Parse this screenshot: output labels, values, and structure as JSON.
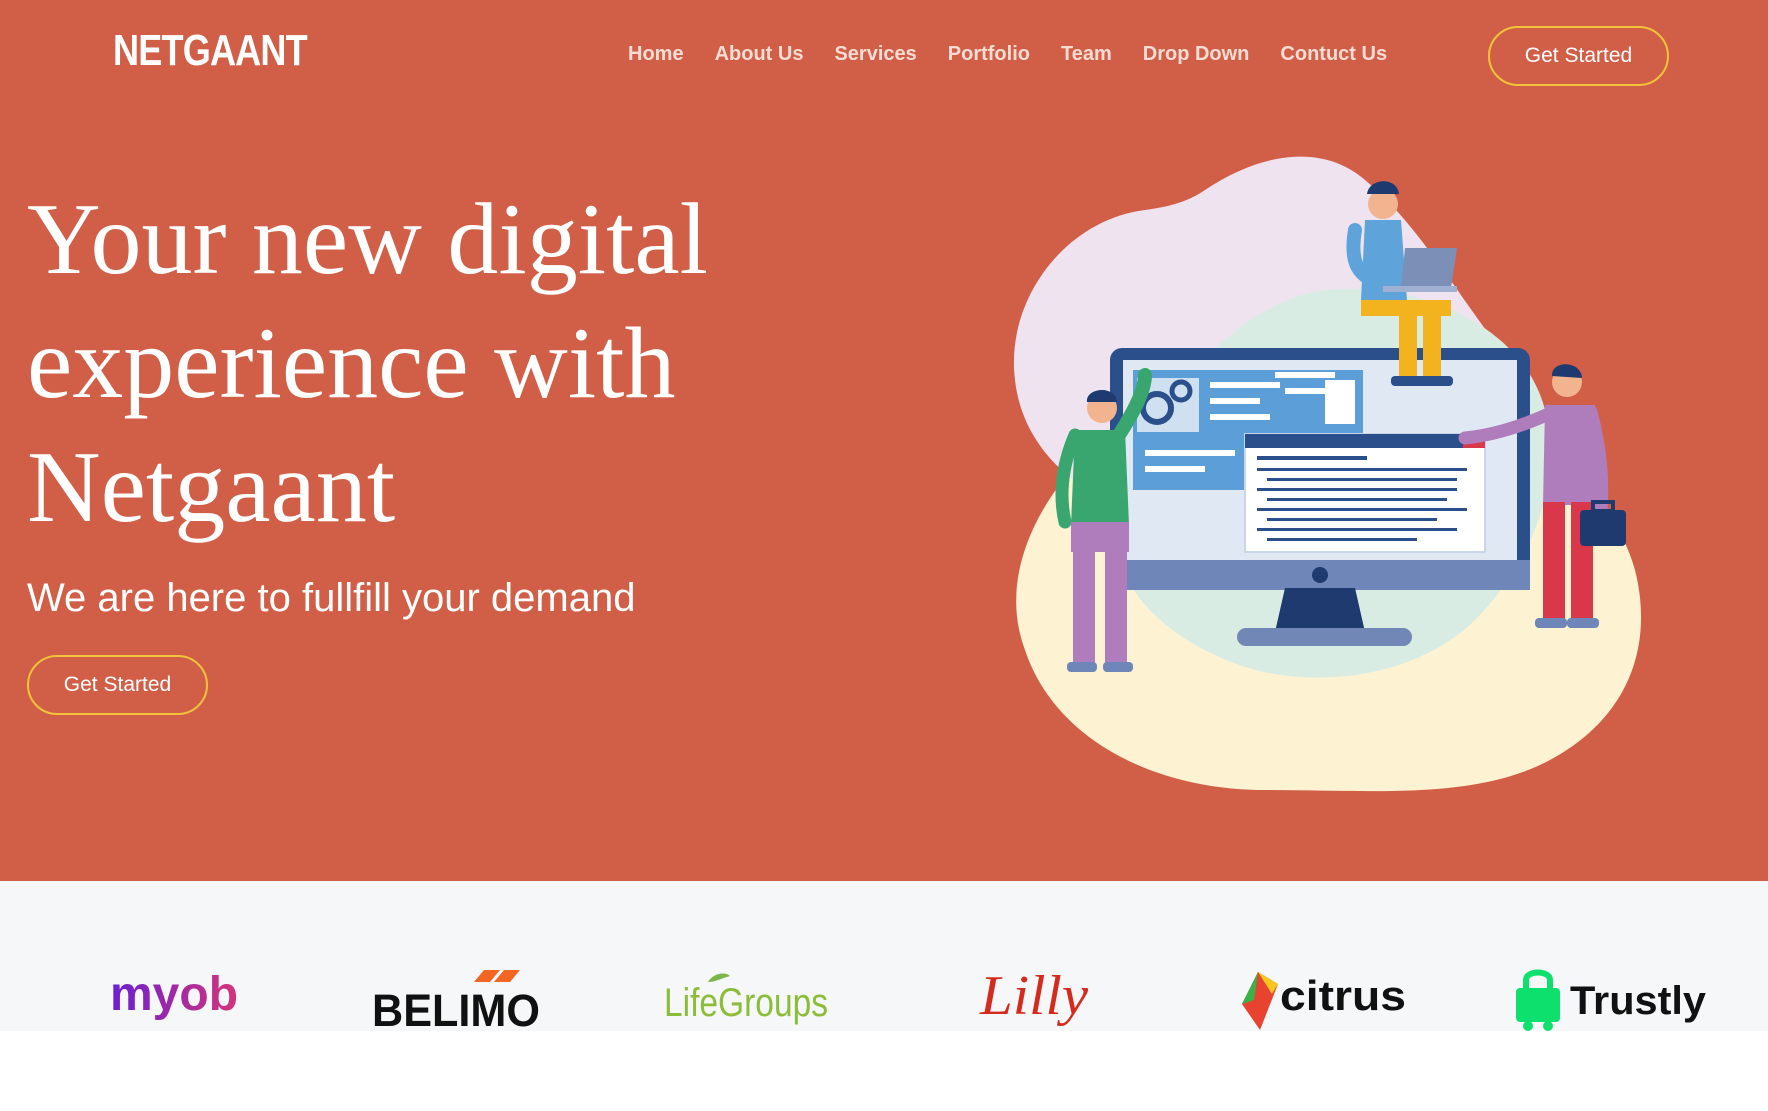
{
  "brand": {
    "name": "NETGAANT"
  },
  "nav": {
    "items": [
      "Home",
      "About Us",
      "Services",
      "Portfolio",
      "Team",
      "Drop Down",
      "Contuct Us"
    ],
    "cta_label": "Get Started"
  },
  "hero": {
    "headline": "Your new digital experience with Netgaant",
    "subheading": "We are here to fullfill your demand",
    "cta_label": "Get Started"
  },
  "clients": [
    {
      "name": "myob",
      "icon": "myob-logo",
      "color": "#6a1fd1"
    },
    {
      "name": "BELIMO",
      "icon": "belimo-logo",
      "color": "#111111"
    },
    {
      "name": "LifeGroups",
      "icon": "lifegroups-logo",
      "color": "#8bbd3a"
    },
    {
      "name": "Lilly",
      "icon": "lilly-logo",
      "color": "#d52b1e"
    },
    {
      "name": "citrus",
      "icon": "citrus-logo",
      "color": "#111111"
    },
    {
      "name": "Trustly",
      "icon": "trustly-logo",
      "color": "#0ee06e"
    }
  ],
  "colors": {
    "hero_bg": "#d15f48",
    "button_border": "#f2c23a",
    "clients_bg": "#f6f7f8"
  }
}
